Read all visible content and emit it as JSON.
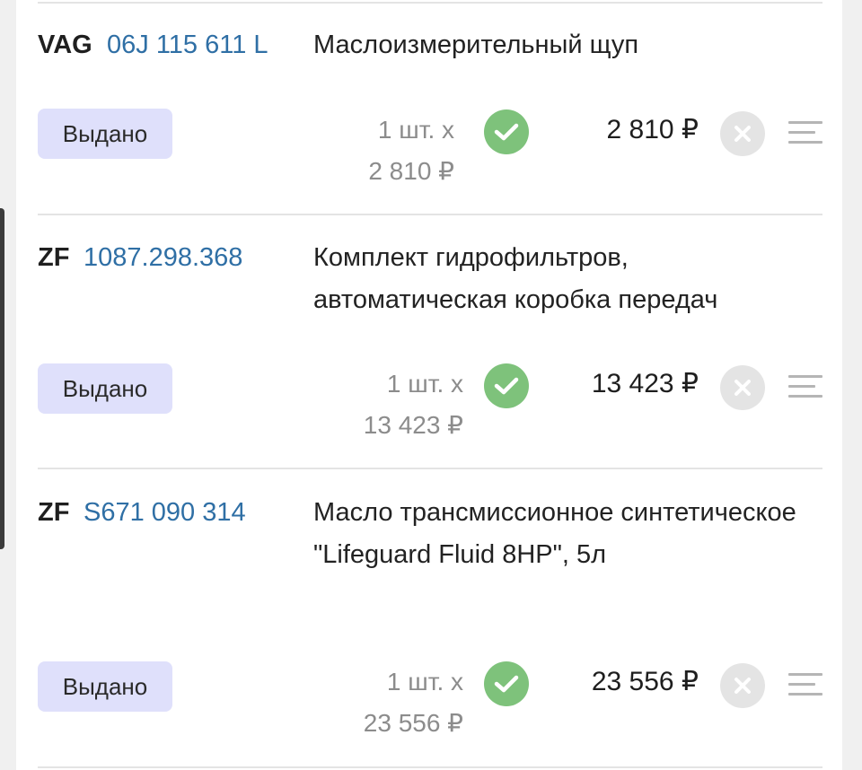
{
  "items": [
    {
      "brand": "VAG",
      "article": "06J 115 611 L",
      "name": "Маслоизмерительный щуп",
      "status": "Выдано",
      "qty": "1 шт. х",
      "unit_price": "2 810 ₽",
      "total": "2 810 ₽"
    },
    {
      "brand": "ZF",
      "article": "1087.298.368",
      "name": "Комплект гидрофильтров, автоматическая коробка передач",
      "status": "Выдано",
      "qty": "1 шт. х",
      "unit_price": "13 423 ₽",
      "total": "13 423 ₽"
    },
    {
      "brand": "ZF",
      "article": "S671 090 314",
      "name": "Масло трансмиссионное синтетическое \"Lifeguard Fluid 8HP\", 5л",
      "status": "Выдано",
      "qty": "1 шт. х",
      "unit_price": "23 556 ₽",
      "total": "23 556 ₽"
    }
  ],
  "colors": {
    "status_bg": "#dfe0fb",
    "article": "#2f6fa5",
    "check": "#7ec27b",
    "remove": "#e4e4e4"
  },
  "icons": {
    "check": "check-circle-icon",
    "remove": "x-circle-icon",
    "menu": "drag-handle-icon"
  }
}
